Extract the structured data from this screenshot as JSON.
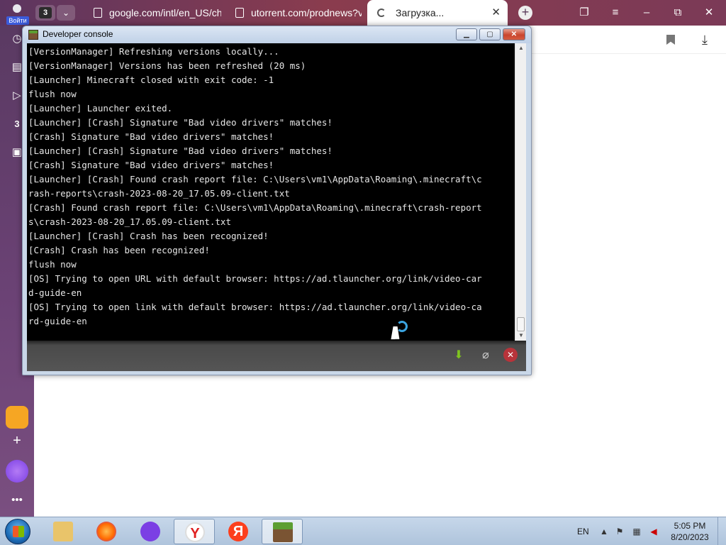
{
  "browser": {
    "profile_label": "Войти",
    "tab_count": "3",
    "tabs": [
      {
        "title": "google.com/intl/en_US/ch"
      },
      {
        "title": "utorrent.com/prodnews?v"
      },
      {
        "title": "Загрузка..."
      }
    ],
    "sidebar_badge": "3"
  },
  "console": {
    "title": "Developer console",
    "log_lines": [
      "[VersionManager] Refreshing versions locally...",
      "[VersionManager] Versions has been refreshed (20 ms)",
      "[Launcher] Minecraft closed with exit code: -1",
      "flush now",
      "[Launcher] Launcher exited.",
      "[Launcher] [Crash] Signature \"Bad video drivers\" matches!",
      "[Crash] Signature \"Bad video drivers\" matches!",
      "[Launcher] [Crash] Signature \"Bad video drivers\" matches!",
      "[Crash] Signature \"Bad video drivers\" matches!",
      "[Launcher] [Crash] Found crash report file: C:\\Users\\vm1\\AppData\\Roaming\\.minecraft\\c",
      "rash-reports\\crash-2023-08-20_17.05.09-client.txt",
      "[Crash] Found crash report file: C:\\Users\\vm1\\AppData\\Roaming\\.minecraft\\crash-report",
      "s\\crash-2023-08-20_17.05.09-client.txt",
      "[Launcher] [Crash] Crash has been recognized!",
      "[Crash] Crash has been recognized!",
      "flush now",
      "[OS] Trying to open URL with default browser: https://ad.tlauncher.org/link/video-car",
      "d-guide-en",
      "[OS] Trying to open link with default browser: https://ad.tlauncher.org/link/video-ca",
      "rd-guide-en"
    ]
  },
  "taskbar": {
    "language": "EN",
    "time": "5:05 PM",
    "date": "8/20/2023"
  },
  "colors": {
    "tabstrip": "#7b3a57",
    "console_bg": "#000000",
    "console_text": "#e6e6e6",
    "taskbar": "#b9cde3"
  }
}
